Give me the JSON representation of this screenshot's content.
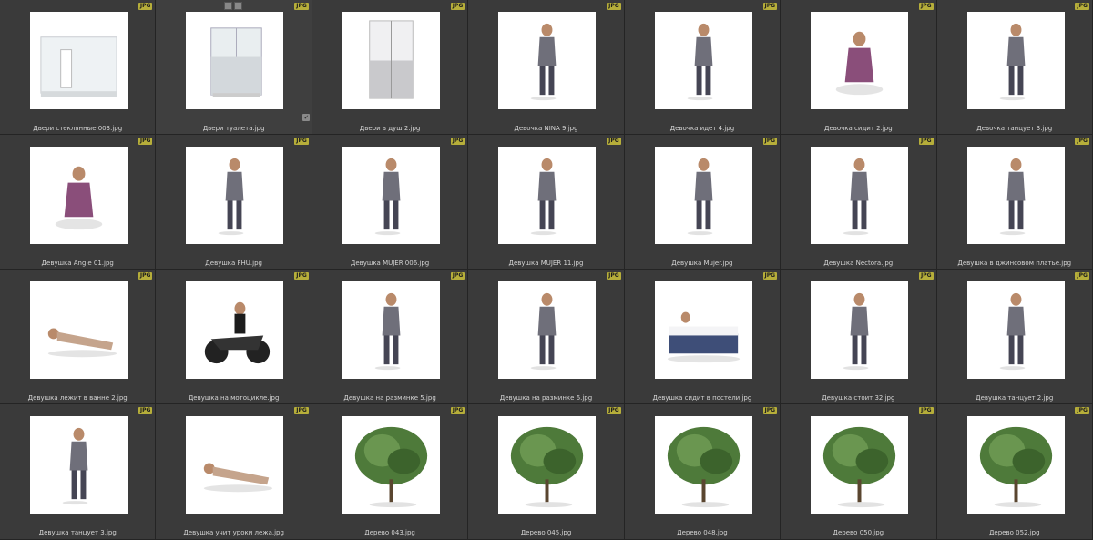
{
  "badge_label": "JPG",
  "items": [
    {
      "label": "Двери стеклянные 003.jpg",
      "kind": "door-glass"
    },
    {
      "label": "Двери туалета.jpg",
      "kind": "door-toilet"
    },
    {
      "label": "Двери в душ 2.jpg",
      "kind": "door-shower"
    },
    {
      "label": "Девочка NINA 9.jpg",
      "kind": "person"
    },
    {
      "label": "Девочка идет 4.jpg",
      "kind": "person"
    },
    {
      "label": "Девочка сидит 2.jpg",
      "kind": "person-sit"
    },
    {
      "label": "Девочка танцует 3.jpg",
      "kind": "person"
    },
    {
      "label": "Девушка Angie 01.jpg",
      "kind": "person-sit"
    },
    {
      "label": "Девушка FHU.jpg",
      "kind": "person"
    },
    {
      "label": "Девушка MUJER 006.jpg",
      "kind": "person"
    },
    {
      "label": "Девушка MUJER 11.jpg",
      "kind": "person"
    },
    {
      "label": "Девушка Mujer.jpg",
      "kind": "person"
    },
    {
      "label": "Девушка Nectora.jpg",
      "kind": "person"
    },
    {
      "label": "Девушка в джинсовом платье.jpg",
      "kind": "person"
    },
    {
      "label": "Девушка лежит в ванне 2.jpg",
      "kind": "person-lie"
    },
    {
      "label": "Девушка на мотоцикле.jpg",
      "kind": "moto"
    },
    {
      "label": "Девушка на разминке 5.jpg",
      "kind": "person"
    },
    {
      "label": "Девушка на разминке 6.jpg",
      "kind": "person"
    },
    {
      "label": "Девушка сидит в постели.jpg",
      "kind": "bed"
    },
    {
      "label": "Девушка стоит 32.jpg",
      "kind": "person"
    },
    {
      "label": "Девушка танцует 2.jpg",
      "kind": "person"
    },
    {
      "label": "Девушка танцует 3.jpg",
      "kind": "person"
    },
    {
      "label": "Девушка учит уроки лежа.jpg",
      "kind": "person-lie"
    },
    {
      "label": "Дерево 043.jpg",
      "kind": "tree"
    },
    {
      "label": "Дерево 045.jpg",
      "kind": "tree"
    },
    {
      "label": "Дерево 048.jpg",
      "kind": "tree"
    },
    {
      "label": "Дерево 050.jpg",
      "kind": "tree"
    },
    {
      "label": "Дерево 052.jpg",
      "kind": "tree"
    }
  ]
}
